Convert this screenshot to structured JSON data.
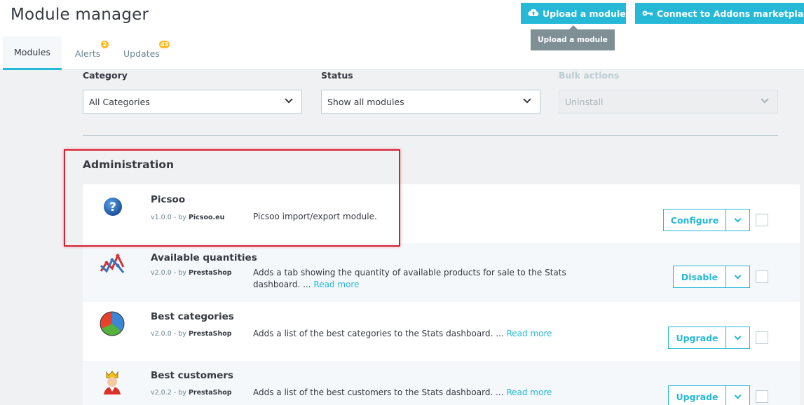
{
  "header": {
    "title": "Module manager",
    "upload_label": "Upload a module",
    "connect_label": "Connect to Addons marketplace",
    "tooltip": "Upload a module"
  },
  "tabs": [
    {
      "label": "Modules",
      "badge": ""
    },
    {
      "label": "Alerts",
      "badge": "2"
    },
    {
      "label": "Updates",
      "badge": "43"
    }
  ],
  "filters": {
    "category": {
      "label": "Category",
      "value": "All Categories"
    },
    "status": {
      "label": "Status",
      "value": "Show all modules"
    },
    "bulk": {
      "label": "Bulk actions",
      "value": "Uninstall"
    }
  },
  "section": {
    "title": "Administration"
  },
  "modules": [
    {
      "name": "Picsoo",
      "version": "v1.0.0 - by",
      "author": "Picsoo.eu",
      "description": "Picsoo import/export module.",
      "read_more": "",
      "action": "Configure"
    },
    {
      "name": "Available quantities",
      "version": "v2.0.0 - by",
      "author": "PrestaShop",
      "description": "Adds a tab showing the quantity of available products for sale to the Stats dashboard. ...",
      "read_more": "Read more",
      "action": "Disable"
    },
    {
      "name": "Best categories",
      "version": "v2.0.0 - by",
      "author": "PrestaShop",
      "description": "Adds a list of the best categories to the Stats dashboard. ...",
      "read_more": "Read more",
      "action": "Upgrade"
    },
    {
      "name": "Best customers",
      "version": "v2.0.2 - by",
      "author": "PrestaShop",
      "description": "Adds a list of the best customers to the Stats dashboard. ...",
      "read_more": "Read more",
      "action": "Upgrade"
    }
  ],
  "icons": [
    "cloud-upload-icon",
    "key-icon",
    "question-icon",
    "line-chart-icon",
    "pie-chart-icon",
    "king-icon",
    "chevron-down-icon"
  ],
  "colors": {
    "accent": "#25b9d7",
    "badge": "#fbbb22",
    "highlight": "#d9202f"
  }
}
